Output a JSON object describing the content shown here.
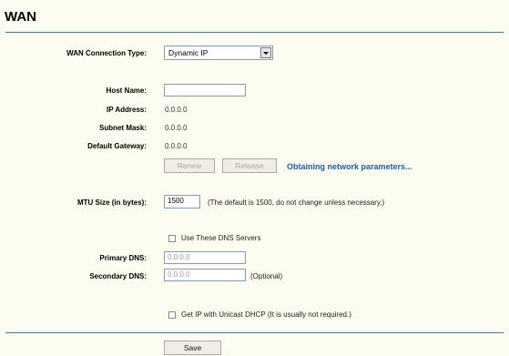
{
  "page": {
    "title": "WAN"
  },
  "form": {
    "conn_type": {
      "label": "WAN Connection Type:",
      "value": "Dynamic IP"
    },
    "host_name": {
      "label": "Host Name:",
      "value": ""
    },
    "ip_address": {
      "label": "IP Address:",
      "value": "0.0.0.0"
    },
    "subnet_mask": {
      "label": "Subnet Mask:",
      "value": "0.0.0.0"
    },
    "default_gateway": {
      "label": "Default Gateway:",
      "value": "0.0.0.0"
    },
    "renew_label": "Renew",
    "release_label": "Release",
    "status_text": "Obtaining network parameters...",
    "mtu": {
      "label": "MTU Size (in bytes):",
      "value": "1500",
      "note": "(The default is 1500, do not change unless necessary.)"
    },
    "use_dns": {
      "label": "Use These DNS Servers",
      "checked": false
    },
    "primary_dns": {
      "label": "Primary DNS:",
      "value": "0.0.0.0"
    },
    "secondary_dns": {
      "label": "Secondary DNS:",
      "value": "0.0.0.0",
      "note": "(Optional)"
    },
    "unicast": {
      "label": "Get IP with Unicast DHCP (It is usually not required.)",
      "checked": false
    },
    "save_label": "Save"
  },
  "colors": {
    "accent": "#2c80c8",
    "status": "#1c5db0",
    "background": "#fcfcf0"
  }
}
